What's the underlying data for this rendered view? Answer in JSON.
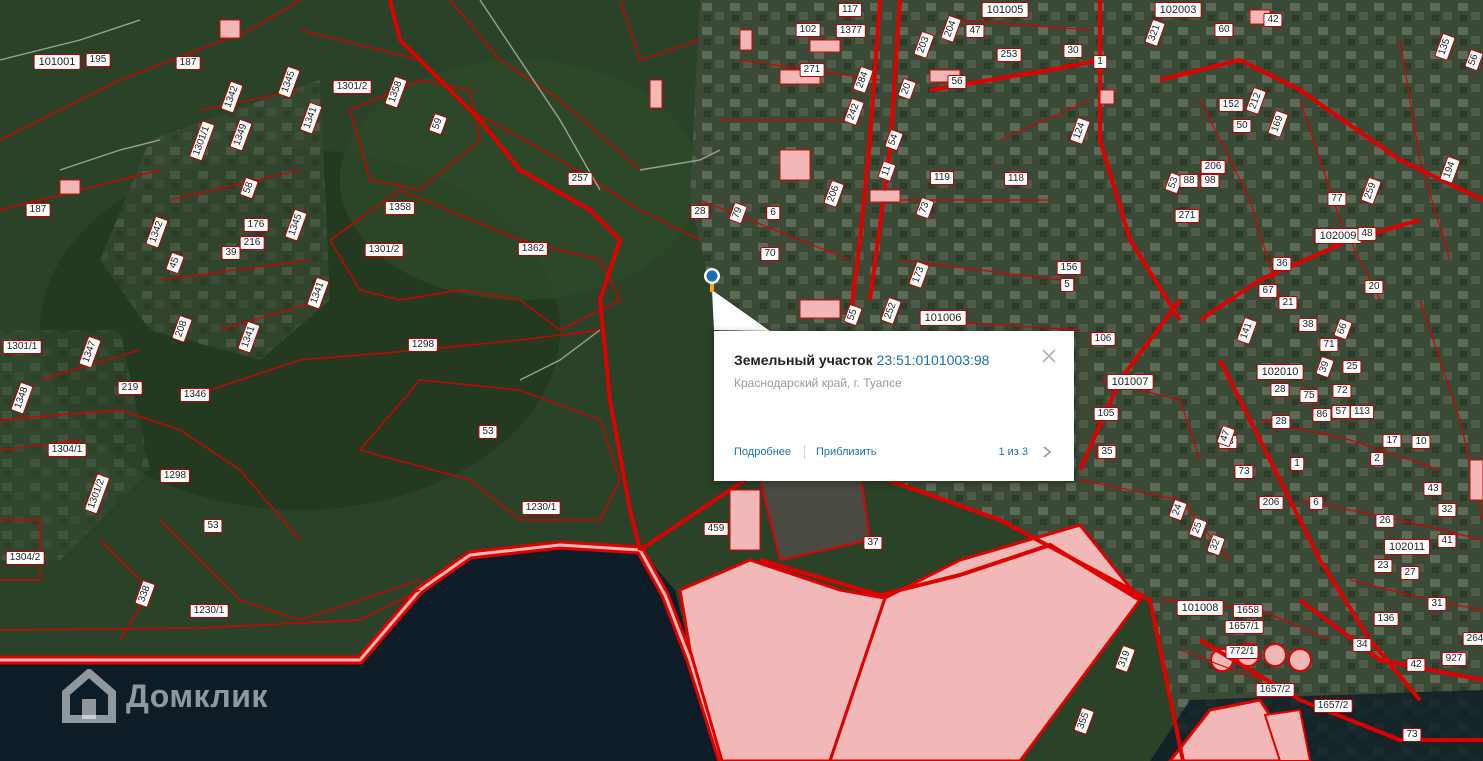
{
  "colors": {
    "forest": "#2a4227",
    "sea": "#0d1c26",
    "parcel_line": "#e00000",
    "parcel_fill": "#f2b8b8",
    "accent": "#1b6fb0"
  },
  "icons": {
    "marker": "map-pin-icon",
    "close": "close-icon",
    "next": "chevron-right-icon",
    "logo": "house-logo-icon"
  },
  "popup": {
    "title_prefix": "Земельный участок",
    "cadastral_number": "23:51:0101003:98",
    "address": "Краснодарский край, г. Туапсе",
    "more_link": "Подробнее",
    "zoom_link": "Приблизить",
    "pager": "1 из 3"
  },
  "logo": {
    "text": "Домклик"
  },
  "quarter_labels": [
    "101001",
    "101005",
    "102003",
    "102009",
    "101006",
    "101007",
    "102010",
    "102011",
    "101008"
  ],
  "parcel_labels": [
    "195",
    "187",
    "187",
    "1301/2",
    "1358",
    "59",
    "257",
    "1358",
    "1301/2",
    "1362",
    "1345",
    "1342",
    "1349",
    "1301/1",
    "1341",
    "58",
    "176",
    "216",
    "39",
    "1345",
    "1342",
    "45",
    "1341",
    "1341",
    "1347",
    "208",
    "219",
    "1346",
    "1298",
    "53",
    "1298",
    "53",
    "1301/1",
    "1348",
    "1304/1",
    "1301/2",
    "1304/2",
    "338",
    "1230/1",
    "1230/1",
    "459",
    "37",
    "35",
    "117",
    "1377",
    "102",
    "271",
    "284",
    "242",
    "203",
    "204",
    "47",
    "253",
    "30",
    "56",
    "1",
    "20",
    "54",
    "11",
    "124",
    "119",
    "118",
    "73",
    "156",
    "5",
    "106",
    "173",
    "252",
    "55",
    "70",
    "28",
    "79",
    "6",
    "206",
    "321",
    "60",
    "42",
    "135",
    "152",
    "212",
    "50",
    "169",
    "53",
    "88",
    "98",
    "206",
    "271",
    "77",
    "259",
    "48",
    "36",
    "67",
    "21",
    "38",
    "71",
    "66",
    "20",
    "39",
    "25",
    "75",
    "86",
    "57",
    "28",
    "73",
    "28",
    "72",
    "141",
    "105",
    "35",
    "43",
    "47",
    "1",
    "206",
    "6",
    "113",
    "2",
    "17",
    "10",
    "43",
    "32",
    "26",
    "41",
    "23",
    "27",
    "34",
    "31",
    "136",
    "42",
    "927",
    "264",
    "1658",
    "1657/1",
    "772/1",
    "1657/2",
    "1657/2",
    "355",
    "319",
    "24",
    "25",
    "32",
    "73",
    "194",
    "56"
  ]
}
